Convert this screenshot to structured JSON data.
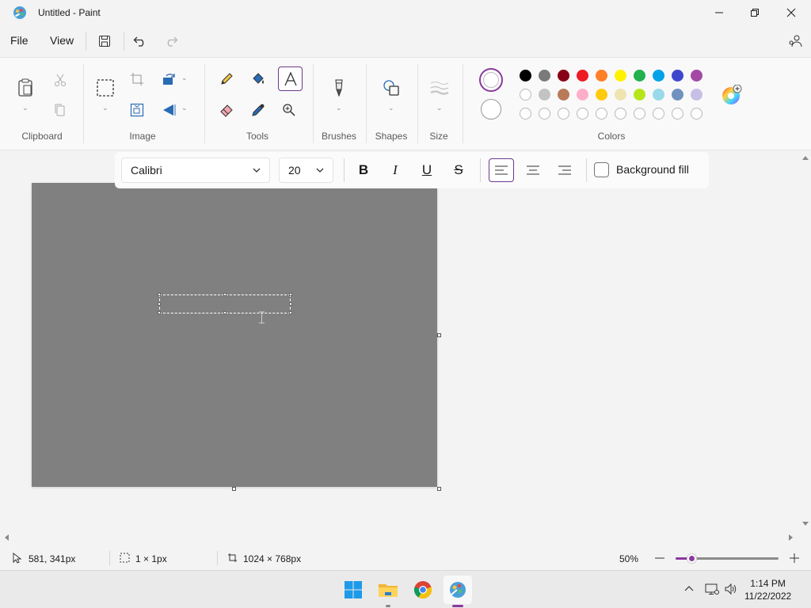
{
  "window": {
    "title": "Untitled - Paint",
    "minimize_icon": "minimize-icon",
    "maximize_icon": "restore-icon",
    "close_icon": "close-icon"
  },
  "menu": {
    "file": "File",
    "view": "View",
    "save_icon": "save-icon",
    "undo_icon": "undo-icon",
    "redo_icon": "redo-icon",
    "share_icon": "share-icon"
  },
  "ribbon": {
    "groups": {
      "clipboard": "Clipboard",
      "image": "Image",
      "tools": "Tools",
      "brushes": "Brushes",
      "shapes": "Shapes",
      "size": "Size",
      "colors": "Colors"
    },
    "colors_row1": [
      "#000000",
      "#7a7a7a",
      "#880015",
      "#ed1c24",
      "#ff7f27",
      "#fff200",
      "#22b14c",
      "#00a2e8",
      "#3f48cc",
      "#a349a4"
    ],
    "colors_row2": [
      "#ffffff",
      "#c3c3c3",
      "#b97a57",
      "#ffaec9",
      "#ffc90e",
      "#efe4b0",
      "#b5e61d",
      "#99d9ea",
      "#7092be",
      "#c8bfe7"
    ],
    "colors_row3_empty": 10
  },
  "text_toolbar": {
    "font": "Calibri",
    "size": "20",
    "bold": "B",
    "italic": "I",
    "underline": "U",
    "strikethrough": "S",
    "background_fill": "Background fill"
  },
  "status": {
    "cursor_pos": "581, 341px",
    "selection_size": "1 × 1px",
    "canvas_size": "1024 × 768px",
    "zoom": "50%",
    "zoom_fraction": 0.15
  },
  "taskbar": {
    "time": "1:14 PM",
    "date": "11/22/2022"
  }
}
